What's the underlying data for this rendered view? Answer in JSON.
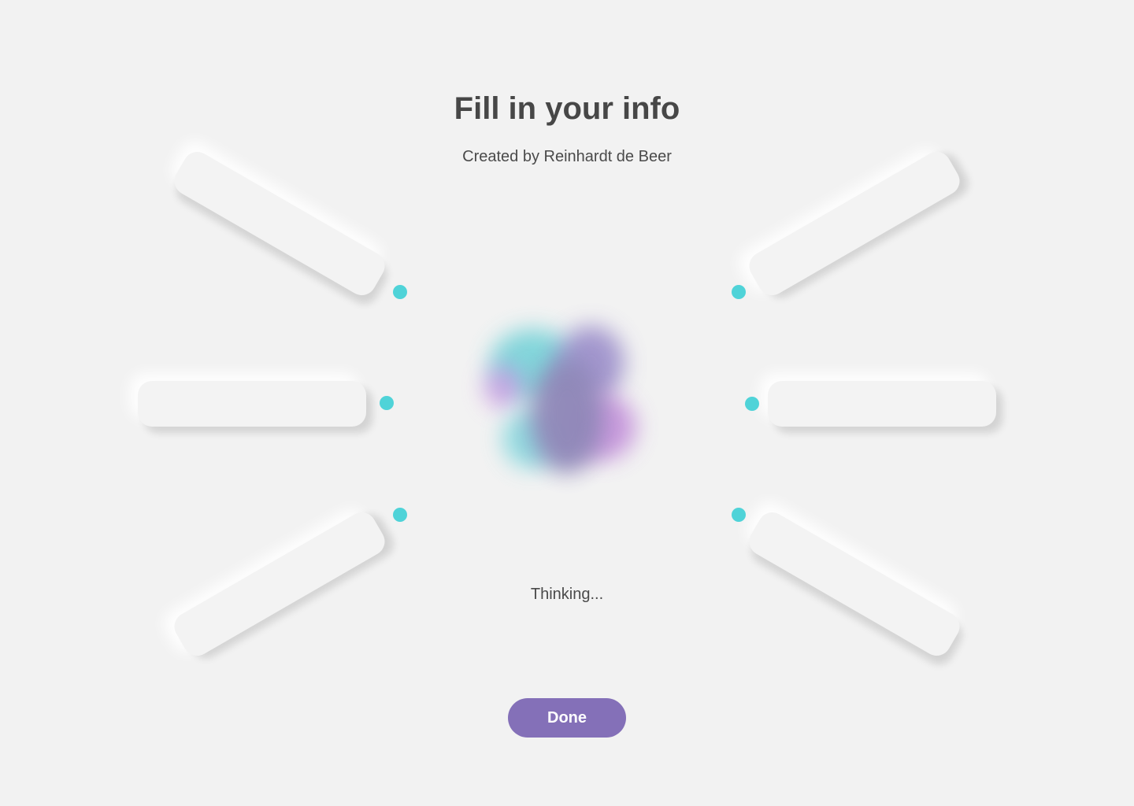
{
  "header": {
    "title": "Fill in your info",
    "subtitle": "Created by Reinhardt de Beer"
  },
  "status": {
    "text": "Thinking..."
  },
  "actions": {
    "done_label": "Done"
  },
  "fields": {
    "count": 6,
    "values": [
      "",
      "",
      "",
      "",
      "",
      ""
    ]
  },
  "colors": {
    "background": "#f2f2f2",
    "accent_dot": "#4fd3d8",
    "button": "#8470b8",
    "title_text": "#474747",
    "blob_teal": "#6fd0d6",
    "blob_purple": "#8f87b8",
    "blob_pink": "#c08ad8"
  }
}
